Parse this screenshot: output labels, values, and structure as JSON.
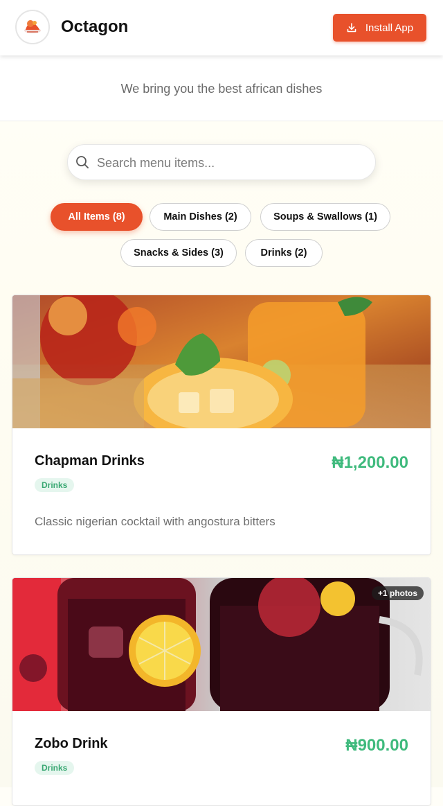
{
  "header": {
    "brand": "Octagon",
    "install_label": "Install App",
    "logo_icon": "restaurant-logo-icon",
    "accent_color": "#e8512b"
  },
  "tagline": "We bring you the best african dishes",
  "search": {
    "placeholder": "Search menu items...",
    "value": ""
  },
  "filters": [
    {
      "label": "All Items (8)",
      "active": true
    },
    {
      "label": "Main Dishes (2)",
      "active": false
    },
    {
      "label": "Soups & Swallows (1)",
      "active": false
    },
    {
      "label": "Snacks & Sides (3)",
      "active": false
    },
    {
      "label": "Drinks (2)",
      "active": false
    }
  ],
  "items": [
    {
      "name": "Chapman Drinks",
      "price": "₦1,200.00",
      "category": "Drinks",
      "description": "Classic nigerian cocktail with angostura bitters",
      "photos_badge": ""
    },
    {
      "name": "Zobo Drink",
      "price": "₦900.00",
      "category": "Drinks",
      "description": "",
      "photos_badge": "+1 photos"
    }
  ],
  "colors": {
    "price": "#3fba7d",
    "tag_bg": "#e5f6ee"
  }
}
